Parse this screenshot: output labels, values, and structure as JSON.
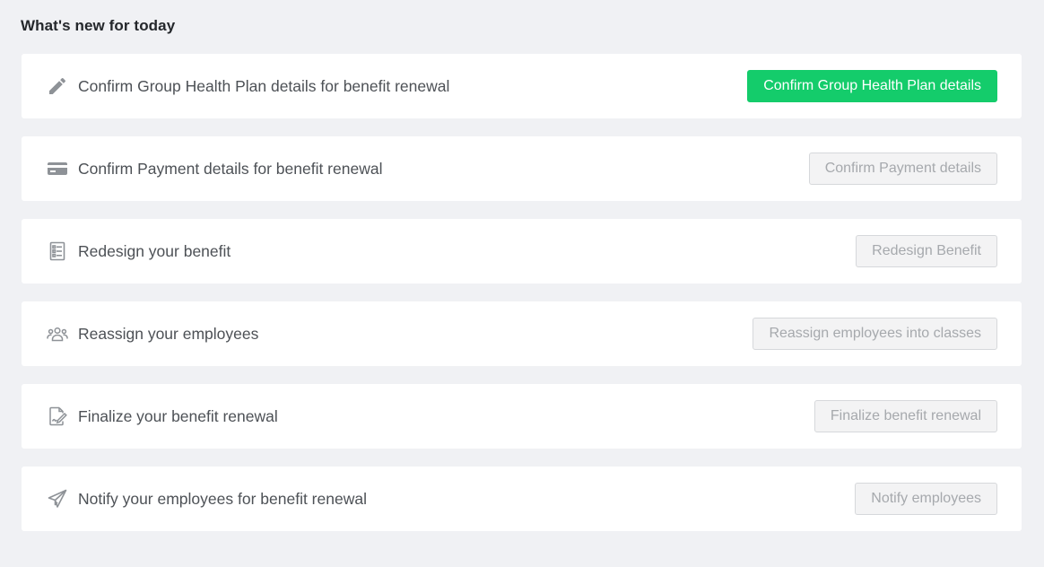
{
  "page": {
    "title": "What's new for today"
  },
  "colors": {
    "background": "#f0f1f4",
    "card": "#ffffff",
    "primary_button": "#14cc6b",
    "disabled_button_bg": "#f3f3f4",
    "disabled_button_text": "#a6a9ad",
    "icon": "#8e9297",
    "label_text": "#4d5156"
  },
  "tasks": [
    {
      "icon": "pencil-icon",
      "label": "Confirm Group Health Plan details for benefit renewal",
      "button_label": "Confirm Group Health Plan details",
      "button_state": "enabled"
    },
    {
      "icon": "credit-card-icon",
      "label": "Confirm Payment details for benefit renewal",
      "button_label": "Confirm Payment details",
      "button_state": "disabled"
    },
    {
      "icon": "checklist-icon",
      "label": "Redesign your benefit",
      "button_label": "Redesign Benefit",
      "button_state": "disabled"
    },
    {
      "icon": "people-group-icon",
      "label": "Reassign your employees",
      "button_label": "Reassign employees into classes",
      "button_state": "disabled"
    },
    {
      "icon": "document-sign-icon",
      "label": "Finalize your benefit renewal",
      "button_label": "Finalize benefit renewal",
      "button_state": "disabled"
    },
    {
      "icon": "paper-plane-icon",
      "label": "Notify your employees for benefit renewal",
      "button_label": "Notify employees",
      "button_state": "disabled"
    }
  ]
}
